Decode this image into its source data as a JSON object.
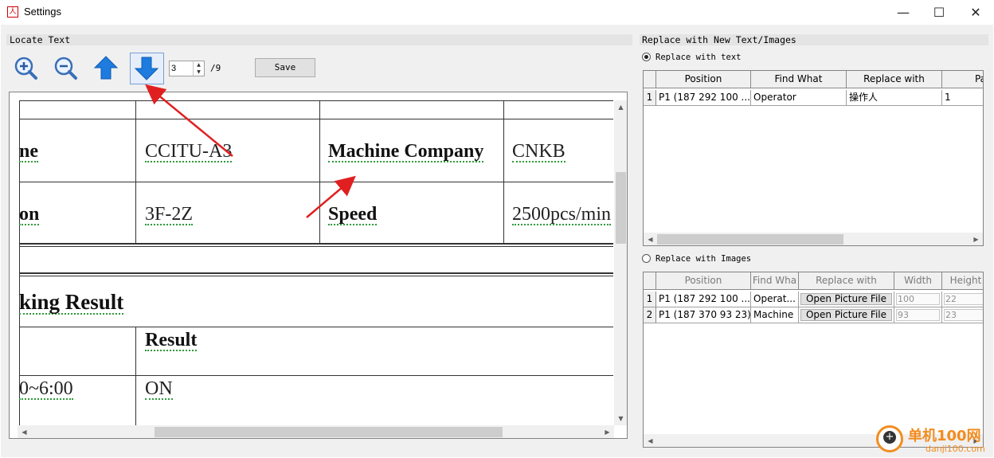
{
  "window": {
    "title": "Settings",
    "minimize_glyph": "—",
    "maximize_glyph": "☐",
    "close_glyph": "✕",
    "app_icon_glyph": "人"
  },
  "locate_text": {
    "group_label": "Locate Text",
    "page_value": "3",
    "page_total": "/9",
    "save_label": "Save",
    "icons": [
      "zoom-in-icon",
      "zoom-out-icon",
      "arrow-up-icon",
      "arrow-down-icon"
    ]
  },
  "preview": {
    "cells": [
      {
        "text": "ne",
        "bold": true
      },
      {
        "text": "CCITU-A3",
        "bold": false
      },
      {
        "text": "Machine Company",
        "bold": true
      },
      {
        "text": "CNKB",
        "bold": false
      },
      {
        "text": "on",
        "bold": true
      },
      {
        "text": "3F-2Z",
        "bold": false
      },
      {
        "text": "Speed",
        "bold": true
      },
      {
        "text": "2500pcs/min",
        "bold": false
      },
      {
        "text": "king Result",
        "bold": true
      },
      {
        "text": "Result",
        "bold": true
      },
      {
        "text": "0~6:00",
        "bold": false
      },
      {
        "text": "ON",
        "bold": false
      }
    ]
  },
  "replace_group": {
    "group_label": "Replace with New Text/Images",
    "text_radio_label": "Replace with text",
    "images_radio_label": "Replace with Images",
    "text_radio_checked": true,
    "text_grid": {
      "headers": [
        "Position",
        "Find What",
        "Replace with",
        "Pa"
      ],
      "rows": [
        {
          "num": "1",
          "position": "P1 (187 292 100 ...",
          "find": "Operator",
          "replace": "操作人",
          "page": "1"
        }
      ]
    },
    "image_grid": {
      "headers": [
        "Position",
        "Find Wha",
        "Replace with",
        "Width",
        "Height"
      ],
      "rows": [
        {
          "num": "1",
          "position": "P1 (187 292 100 ...",
          "find": "Operat...",
          "button": "Open Picture File",
          "width": "100",
          "height": "22"
        },
        {
          "num": "2",
          "position": "P1 (187 370 93 23)",
          "find": "Machine",
          "button": "Open Picture File",
          "width": "93",
          "height": "23"
        }
      ]
    }
  },
  "watermark": {
    "line1": "单机100网",
    "line2": "danji100.com"
  },
  "colors": {
    "accent_blue": "#1e7be0",
    "annotation_red": "#e02020",
    "dotted_green": "#2e9a3a",
    "watermark_orange": "#f28c1f"
  }
}
